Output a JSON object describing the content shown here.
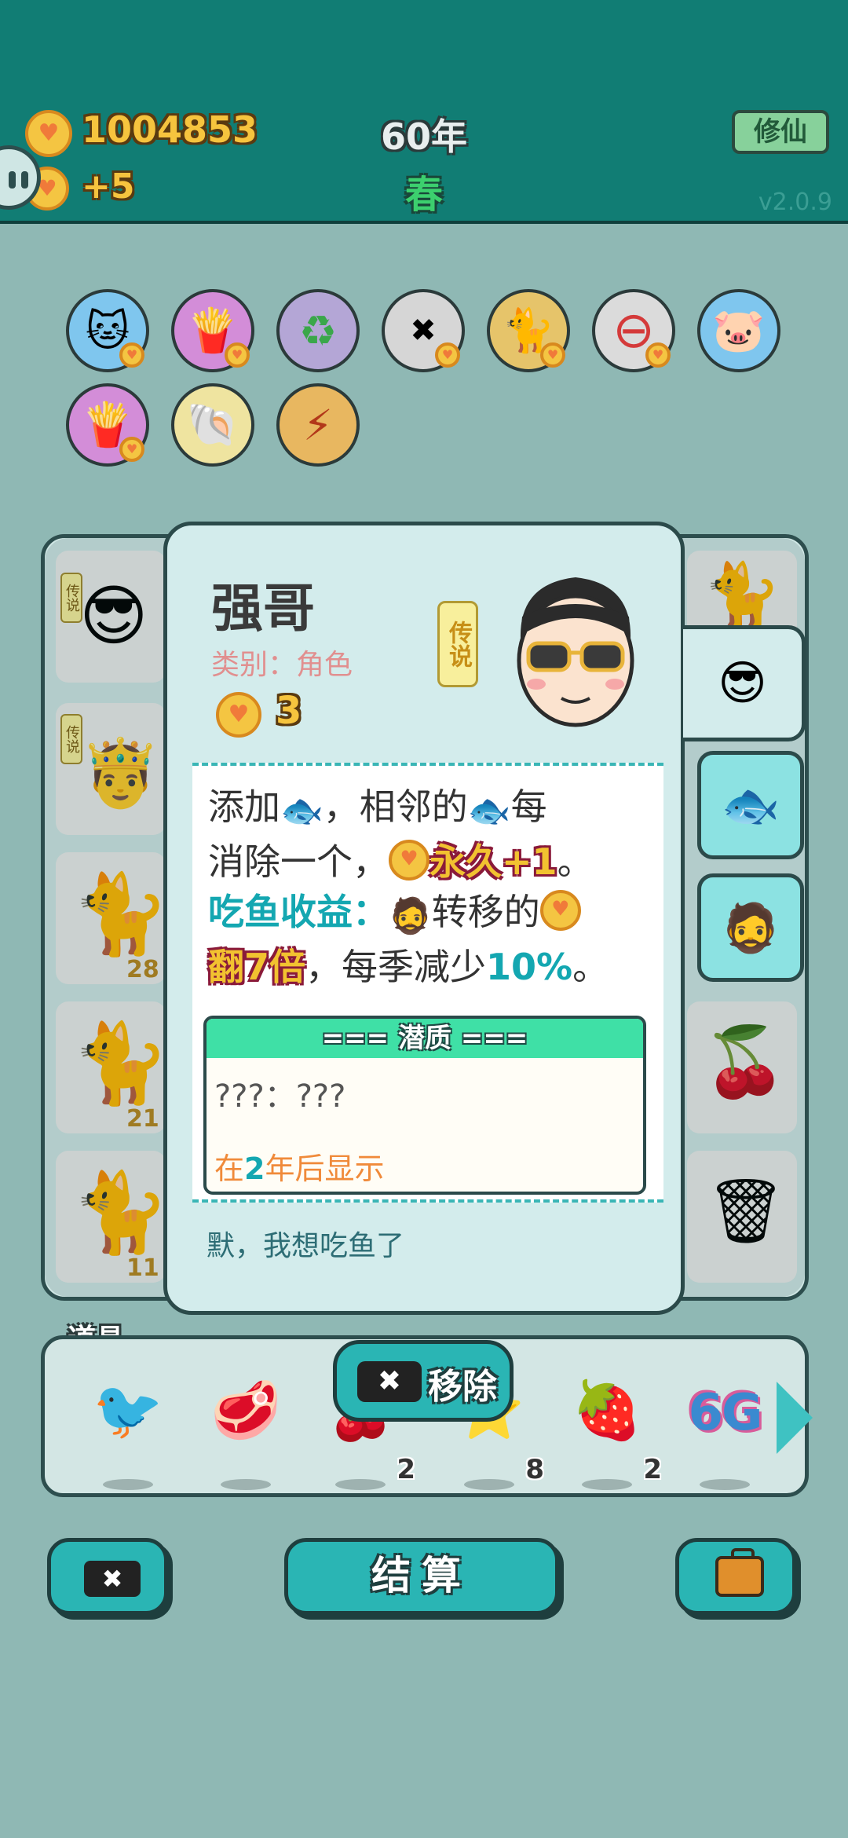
{
  "header": {
    "coins": "1004853",
    "income": "+5",
    "year": "60年",
    "season": "春",
    "xiuxian_label": "修仙",
    "version": "v2.0.9"
  },
  "icons_row1": [
    "cat-coin-icon",
    "fries-icon",
    "recycle-icon",
    "remove-tag-icon",
    "twin-cats-icon",
    "minus-icon",
    "piggy-bank-icon"
  ],
  "icons_row2": [
    "fries-icon",
    "shell-icon",
    "lightning-icon"
  ],
  "board": {
    "legend_tag": "传说",
    "cell_numbers": [
      "28",
      "21",
      "11"
    ]
  },
  "card": {
    "name": "强哥",
    "type": "类别：角色",
    "value": "3",
    "rarity": "传说",
    "desc": {
      "p1": "添加",
      "p2": "，相邻的",
      "p3": "每",
      "p4": "消除一个，",
      "p5": "永久+1",
      "p6": "。",
      "p7": "吃鱼收益：",
      "p8": "转移的",
      "p9": "翻7倍",
      "p10": "，每季减少",
      "p11": "10%",
      "p12": "。"
    },
    "potential": {
      "header": "=== 潜质 ===",
      "body": "???：???",
      "reveal_pre": "在",
      "reveal_num": "2",
      "reveal_post": "年后显示"
    },
    "quote": "默，我想吃鱼了"
  },
  "props": {
    "label": "道具",
    "counts": [
      "2",
      "8",
      "2"
    ],
    "six_g": "6G",
    "remove_label": "移除"
  },
  "bottom": {
    "settle_label": "结算"
  },
  "colors": {
    "header_bg": "#117d74",
    "accent": "#2ab5b4",
    "gold": "#f6c43e",
    "page_bg": "#8fb8b4"
  }
}
